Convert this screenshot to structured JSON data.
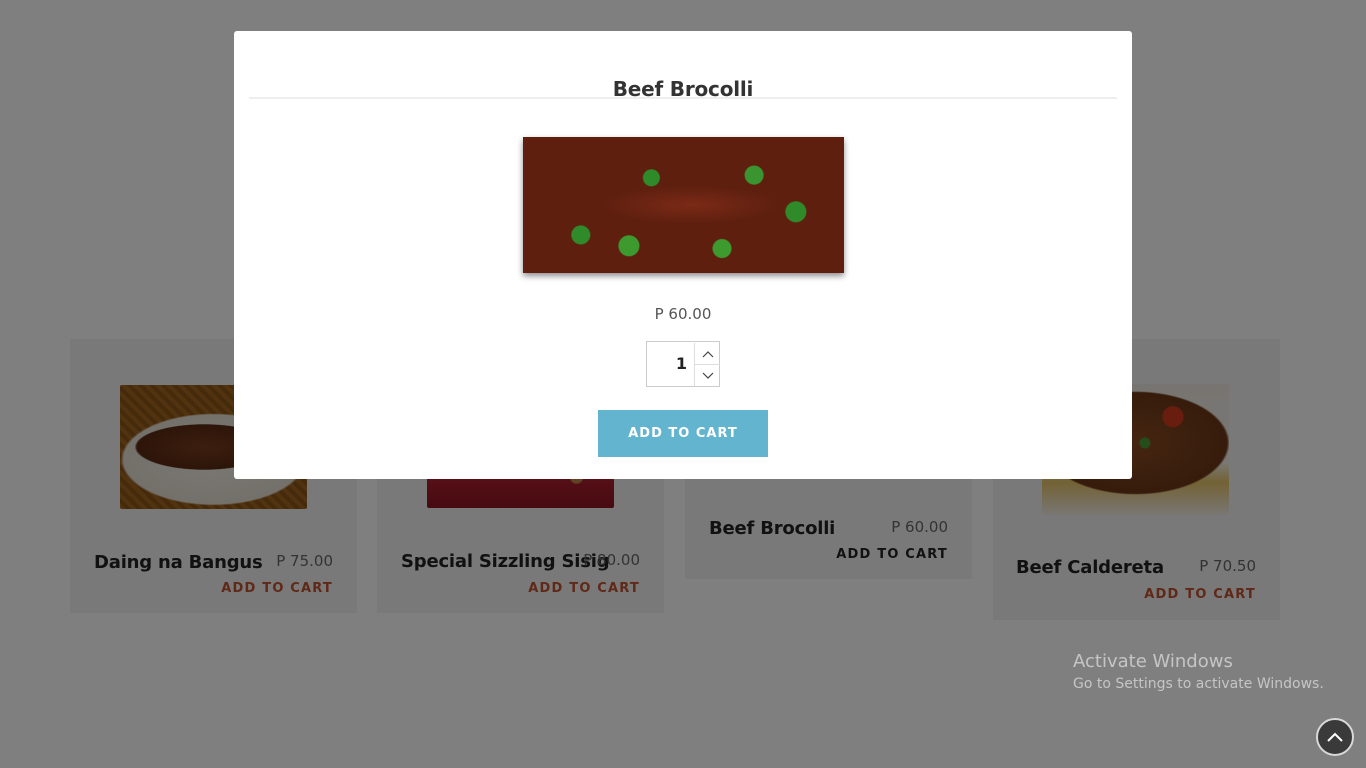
{
  "menu": {
    "items": [
      {
        "name": "Daing na Bangus",
        "price": "P 75.00",
        "cart_label": "ADD TO CART"
      },
      {
        "name": "Special Sizzling Sisig",
        "price": "P 80.00",
        "cart_label": "ADD TO CART"
      },
      {
        "name": "Beef Brocolli",
        "price": "P 60.00",
        "cart_label": "ADD TO CART"
      },
      {
        "name": "Beef Caldereta",
        "price": "P 70.50",
        "cart_label": "ADD TO CART"
      }
    ]
  },
  "modal": {
    "title": "Beef Brocolli",
    "price": "P 60.00",
    "quantity": "1",
    "add_button_label": "ADD TO CART"
  },
  "watermark": {
    "line1": "Activate Windows",
    "line2": "Go to Settings to activate Windows."
  },
  "icons": {
    "scroll_top": "chevron-up-circle-icon",
    "qty_up": "chevron-up-icon",
    "qty_down": "chevron-down-icon"
  },
  "colors": {
    "accent_button": "#63b4cf",
    "cart_link": "#c0502e",
    "overlay": "rgba(0,0,0,0.5)"
  }
}
